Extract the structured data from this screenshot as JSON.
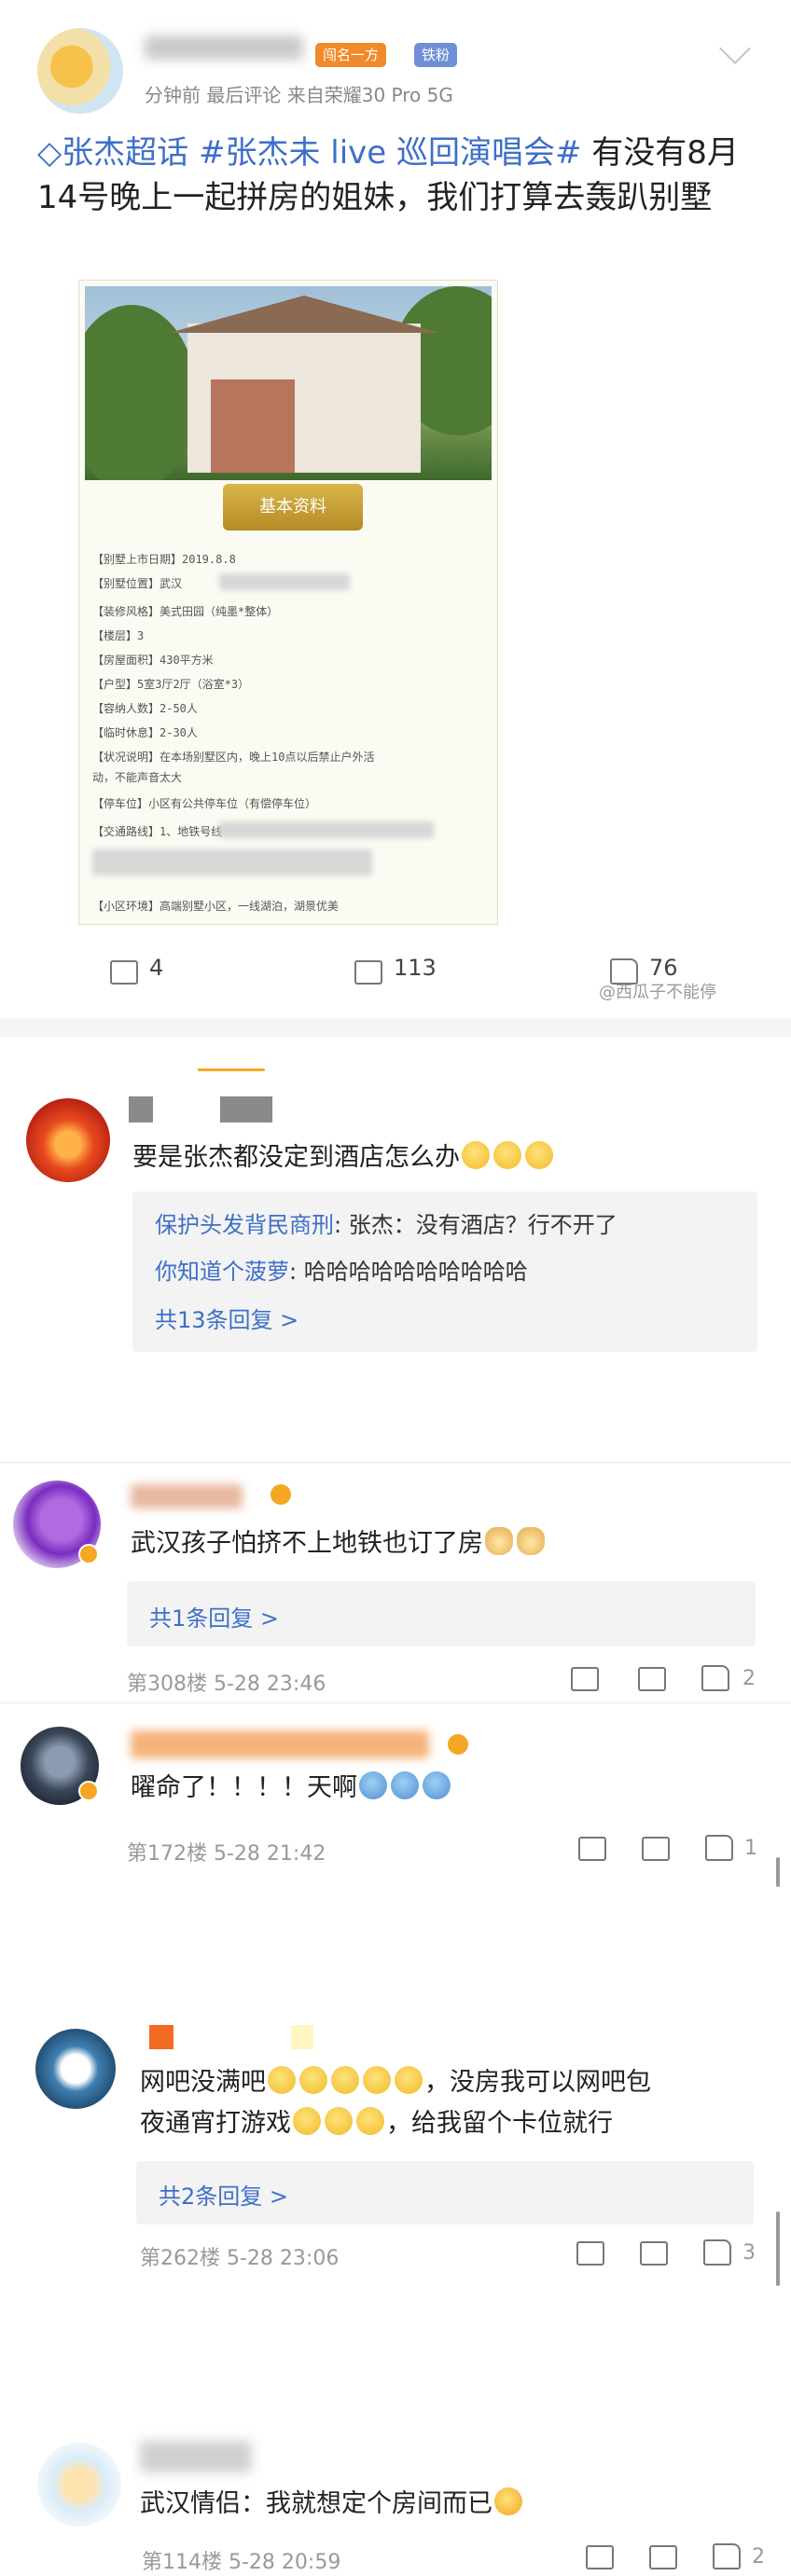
{
  "post": {
    "badges": [
      "闯名一方",
      "铁粉"
    ],
    "meta": "分钟前 最后评论 来自荣耀30 Pro 5G",
    "topics": [
      "张杰超话",
      "#张杰未 live 巡回演唱会#"
    ],
    "text": " 有没有8月14号晚上一起拼房的姐妹，我们打算去轰趴别墅",
    "image": {
      "button_label": "基本资料",
      "lines": [
        "【别墅上市日期】2019.8.8",
        "【别墅位置】武汉",
        "【装修风格】美式田园（纯墨*整体）",
        "【楼层】3",
        "【房屋面积】430平方米",
        "【户型】5室3厅2厅（浴室*3）",
        "【容纳人数】2-50人",
        "【临时休息】2-30人",
        "【状况说明】在本场别墅区内，晚上10点以后禁止户外活",
        "动，不能声音太大",
        "【停车位】小区有公共停车位（有偿停车位）",
        "【交通路线】1、地铁号线",
        "【小区环境】高端别墅小区，一线湖泊，湖景优美"
      ]
    },
    "share_count": "4",
    "comment_count": "113",
    "like_count": "76",
    "watermark": "@西瓜子不能停"
  },
  "comments": [
    {
      "text": "要是张杰都没定到酒店怎么办",
      "replies": [
        {
          "name": "保护头发背民商刑",
          "text": ": 张杰：没有酒店？行不开了"
        },
        {
          "name": "你知道个菠萝",
          "text": ": 哈哈哈哈哈哈哈哈哈哈"
        }
      ],
      "more_replies": "共13条回复 >"
    },
    {
      "text": "武汉孩子怕挤不上地铁也订了房",
      "more_replies": "共1条回复 >",
      "floor": "第308楼",
      "time": "5-28 23:46",
      "likes": "2"
    },
    {
      "text": "曜命了！！！！天啊",
      "floor": "第172楼",
      "time": "5-28 21:42",
      "likes": "1"
    },
    {
      "text1": "网吧没满吧",
      "text2": "，没房我可以网吧包",
      "text3": "夜通宵打游戏",
      "text4": "，给我留个卡位就行",
      "more_replies": "共2条回复 >",
      "floor": "第262楼",
      "time": "5-28 23:06",
      "likes": "3"
    },
    {
      "text": "武汉情侣：我就想定个房间而已",
      "floor": "第114楼",
      "time": "5-28 20:59",
      "likes": "2"
    }
  ]
}
